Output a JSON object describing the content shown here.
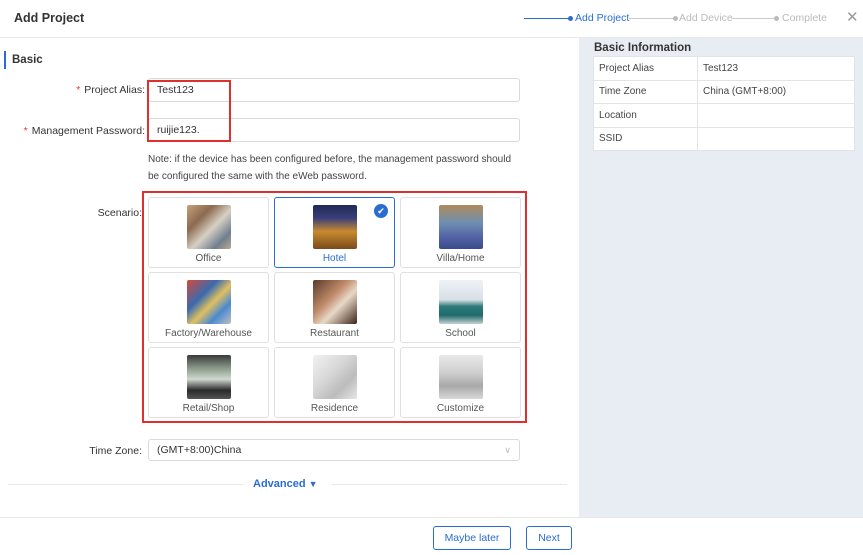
{
  "header": {
    "title": "Add Project",
    "steps": [
      {
        "label": "Add Project",
        "active": true
      },
      {
        "label": "Add Device",
        "active": false
      },
      {
        "label": "Complete",
        "active": false
      }
    ],
    "close_symbol": "✕"
  },
  "basic": {
    "section_label": "Basic",
    "project_alias_label": "Project Alias:",
    "project_alias_value": "Test123",
    "password_label": "Management Password:",
    "password_value": "ruijie123.",
    "required_mark": "*",
    "note": "Note: if the device has been configured before, the management password should be configured the same with the eWeb password.",
    "scenario_label": "Scenario:",
    "scenarios": [
      {
        "label": "Office",
        "icon": "office-photo",
        "selected": false
      },
      {
        "label": "Hotel",
        "icon": "hotel-photo",
        "selected": true
      },
      {
        "label": "Villa/Home",
        "icon": "villa-photo",
        "selected": false
      },
      {
        "label": "Factory/Warehouse",
        "icon": "factory-photo",
        "selected": false
      },
      {
        "label": "Restaurant",
        "icon": "restaurant-photo",
        "selected": false
      },
      {
        "label": "School",
        "icon": "school-photo",
        "selected": false
      },
      {
        "label": "Retail/Shop",
        "icon": "retail-photo",
        "selected": false
      },
      {
        "label": "Residence",
        "icon": "residence-photo",
        "selected": false
      },
      {
        "label": "Customize",
        "icon": "customize-photo",
        "selected": false
      }
    ],
    "timezone_label": "Time Zone:",
    "timezone_value": "(GMT+8:00)China",
    "advanced_label": "Advanced"
  },
  "info": {
    "title": "Basic Information",
    "rows": [
      {
        "key": "Project Alias",
        "value": "Test123"
      },
      {
        "key": "Time Zone",
        "value": "China (GMT+8:00)"
      },
      {
        "key": "Location",
        "value": ""
      },
      {
        "key": "SSID",
        "value": ""
      }
    ]
  },
  "footer": {
    "maybe_later_label": "Maybe later",
    "next_label": "Next"
  },
  "colors": {
    "accent": "#2b6cd3",
    "highlight_red": "#e0302e",
    "panel_bg": "#e8edf3"
  }
}
